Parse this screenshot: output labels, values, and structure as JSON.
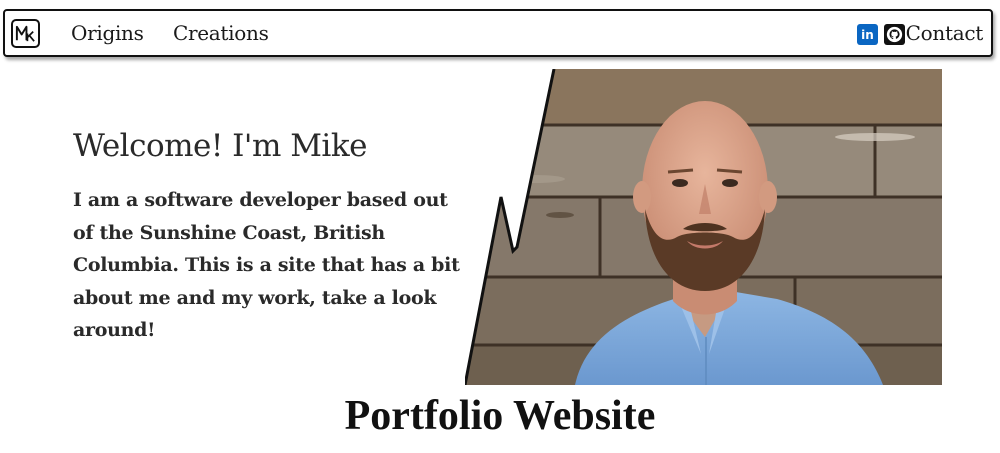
{
  "nav": {
    "logo_text": "MK",
    "links": [
      "Origins",
      "Creations"
    ],
    "social_icons": [
      "linkedin-icon",
      "github-icon"
    ],
    "linkedin_text": "in",
    "contact": "Contact"
  },
  "hero": {
    "title": "Welcome! I'm Mike",
    "body": "I am a software developer based out of the Sunshine Coast, British Columbia. This is a site that has a bit about me and my work, take a look around!"
  },
  "footer": {
    "title": "Portfolio Website"
  },
  "colors": {
    "linkedin": "#0a66c2",
    "github": "#111111",
    "shirt": "#7aa7d8",
    "wood": "#7a6a58"
  }
}
